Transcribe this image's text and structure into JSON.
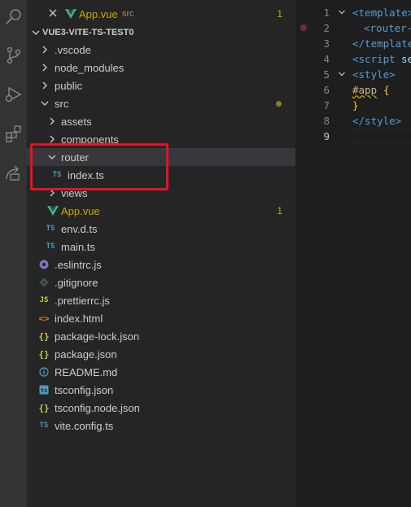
{
  "open_editor": {
    "filename": "App.vue",
    "folder": "src",
    "problems": "1"
  },
  "explorer": {
    "project": "VUE3-VITE-TS-TEST0",
    "items": [
      {
        "label": ".vscode"
      },
      {
        "label": "node_modules"
      },
      {
        "label": "public"
      },
      {
        "label": "src"
      },
      {
        "label": "assets"
      },
      {
        "label": "components"
      },
      {
        "label": "router"
      },
      {
        "label": "index.ts"
      },
      {
        "label": "views"
      },
      {
        "label": "App.vue",
        "badge": "1"
      },
      {
        "label": "env.d.ts"
      },
      {
        "label": "main.ts"
      },
      {
        "label": ".eslintrc.js"
      },
      {
        "label": ".gitignore"
      },
      {
        "label": ".prettierrc.js"
      },
      {
        "label": "index.html"
      },
      {
        "label": "package-lock.json"
      },
      {
        "label": "package.json"
      },
      {
        "label": "README.md"
      },
      {
        "label": "tsconfig.json"
      },
      {
        "label": "tsconfig.node.json"
      },
      {
        "label": "vite.config.ts"
      }
    ]
  },
  "file_icons": {
    "ts": "TS",
    "js": "JS",
    "json": "{}",
    "html": "<>"
  },
  "editor": {
    "line_numbers": [
      "1",
      "2",
      "3",
      "4",
      "5",
      "6",
      "7",
      "8",
      "9"
    ],
    "lines": {
      "l1_tag": "<template>",
      "l2_tag": "<router-",
      "l3_tag": "</template",
      "l4_tag": "<script",
      "l4_attr": "se",
      "l5_tag": "<style>",
      "l6_sel": "#app",
      "l6_brace": "{",
      "l7_brace": "}",
      "l8_tag": "</style>"
    }
  },
  "colors": {
    "highlight": "#e81123",
    "vue": "#41b883",
    "ts": "#519aba",
    "warning": "#cca700"
  }
}
